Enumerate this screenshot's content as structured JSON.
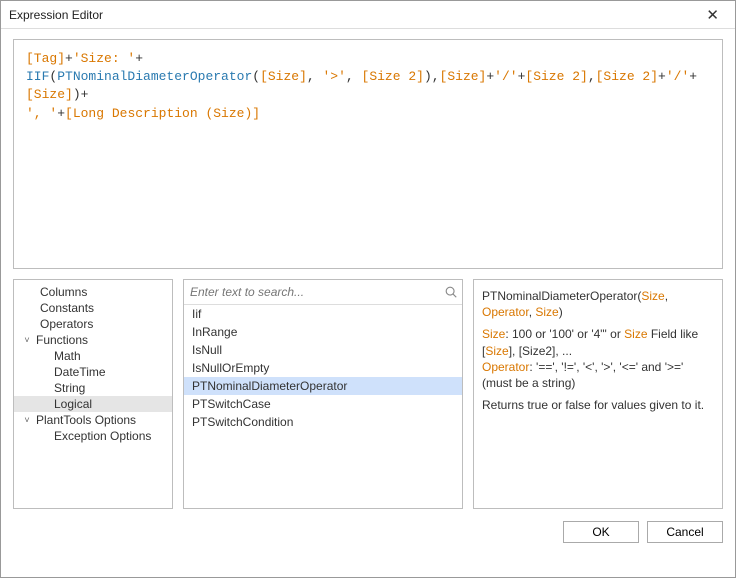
{
  "window": {
    "title": "Expression Editor",
    "close_glyph": "✕"
  },
  "expression": {
    "tokens": [
      {
        "t": "bracket",
        "v": "[Tag]"
      },
      {
        "t": "plain",
        "v": "+"
      },
      {
        "t": "string",
        "v": "'Size: '"
      },
      {
        "t": "plain",
        "v": "+\n"
      },
      {
        "t": "func",
        "v": "IIF"
      },
      {
        "t": "plain",
        "v": "("
      },
      {
        "t": "func",
        "v": "PTNominalDiameterOperator"
      },
      {
        "t": "plain",
        "v": "("
      },
      {
        "t": "bracket",
        "v": "[Size]"
      },
      {
        "t": "plain",
        "v": ", "
      },
      {
        "t": "string",
        "v": "'>'"
      },
      {
        "t": "plain",
        "v": ", "
      },
      {
        "t": "bracket",
        "v": "[Size 2]"
      },
      {
        "t": "plain",
        "v": "),"
      },
      {
        "t": "bracket",
        "v": "[Size]"
      },
      {
        "t": "plain",
        "v": "+"
      },
      {
        "t": "string",
        "v": "'/'"
      },
      {
        "t": "plain",
        "v": "+"
      },
      {
        "t": "bracket",
        "v": "[Size 2]"
      },
      {
        "t": "plain",
        "v": ","
      },
      {
        "t": "bracket",
        "v": "[Size 2]"
      },
      {
        "t": "plain",
        "v": "+"
      },
      {
        "t": "string",
        "v": "'/'"
      },
      {
        "t": "plain",
        "v": "+"
      },
      {
        "t": "bracket",
        "v": "[Size]"
      },
      {
        "t": "plain",
        "v": ")+\n"
      },
      {
        "t": "string",
        "v": "', '"
      },
      {
        "t": "plain",
        "v": "+"
      },
      {
        "t": "bracket",
        "v": "[Long Description (Size)]"
      }
    ]
  },
  "tree": {
    "items": [
      {
        "label": "Columns",
        "indent": 1,
        "expander": ""
      },
      {
        "label": "Constants",
        "indent": 1,
        "expander": ""
      },
      {
        "label": "Operators",
        "indent": 1,
        "expander": ""
      },
      {
        "label": "Functions",
        "indent": 0,
        "expander": "v"
      },
      {
        "label": "Math",
        "indent": 2,
        "expander": ""
      },
      {
        "label": "DateTime",
        "indent": 2,
        "expander": ""
      },
      {
        "label": "String",
        "indent": 2,
        "expander": ""
      },
      {
        "label": "Logical",
        "indent": 2,
        "expander": "",
        "selected": true
      },
      {
        "label": "PlantTools Options",
        "indent": 0,
        "expander": "v"
      },
      {
        "label": "Exception Options",
        "indent": 2,
        "expander": ""
      }
    ]
  },
  "search": {
    "placeholder": "Enter text to search..."
  },
  "functions": {
    "items": [
      {
        "label": "Iif"
      },
      {
        "label": "InRange"
      },
      {
        "label": "IsNull"
      },
      {
        "label": "IsNullOrEmpty"
      },
      {
        "label": "PTNominalDiameterOperator",
        "selected": true
      },
      {
        "label": "PTSwitchCase"
      },
      {
        "label": "PTSwitchCondition"
      }
    ]
  },
  "description": {
    "sig_func": "PTNominalDiameterOperator",
    "sig_open": "(",
    "sig_p1": "Size",
    "sig_sep1": ", ",
    "sig_p2": "Operator",
    "sig_sep2": ", ",
    "sig_p3": "Size",
    "sig_close": ")",
    "size_label": "Size",
    "size_text1": ": 100 or '100' or '4\"' or ",
    "size_text2": " Field like [",
    "size_text3": "], [Size2], ...",
    "op_label": "Operator",
    "op_text": ": '==', '!=', '<', '>', '<=' and '>='",
    "op_note": "(must be a string)",
    "returns": "Returns true or false for values given to it."
  },
  "footer": {
    "ok": "OK",
    "cancel": "Cancel"
  }
}
